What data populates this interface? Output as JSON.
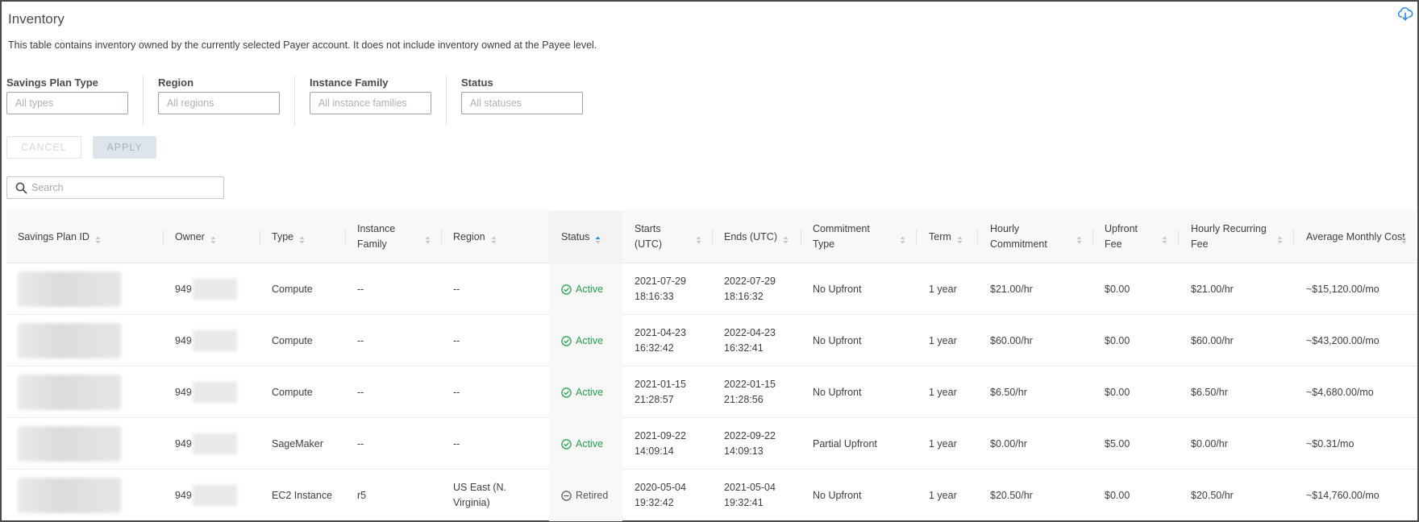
{
  "header": {
    "title": "Inventory",
    "description": "This table contains inventory owned by the currently selected Payer account. It does not include inventory owned at the Payee level.",
    "download_icon": "cloud-download-icon"
  },
  "filters": [
    {
      "label": "Savings Plan Type",
      "placeholder": "All types",
      "value": ""
    },
    {
      "label": "Region",
      "placeholder": "All regions",
      "value": ""
    },
    {
      "label": "Instance Family",
      "placeholder": "All instance families",
      "value": ""
    },
    {
      "label": "Status",
      "placeholder": "All statuses",
      "value": ""
    }
  ],
  "actions": {
    "cancel_label": "CANCEL",
    "apply_label": "APPLY"
  },
  "search": {
    "placeholder": "Search",
    "value": "",
    "icon": "search-icon"
  },
  "table": {
    "columns": [
      {
        "label": "Savings Plan ID",
        "sort": "none"
      },
      {
        "label": "Owner",
        "sort": "none"
      },
      {
        "label": "Type",
        "sort": "none"
      },
      {
        "label": "Instance Family",
        "sort": "none"
      },
      {
        "label": "Region",
        "sort": "none"
      },
      {
        "label": "Status",
        "sort": "ascending"
      },
      {
        "label": "Starts (UTC)",
        "sort": "none"
      },
      {
        "label": "Ends (UTC)",
        "sort": "none"
      },
      {
        "label": "Commitment Type",
        "sort": "none"
      },
      {
        "label": "Term",
        "sort": "none"
      },
      {
        "label": "Hourly Commitment",
        "sort": "none"
      },
      {
        "label": "Upfront Fee",
        "sort": "none"
      },
      {
        "label": "Hourly Recurring Fee",
        "sort": "none"
      },
      {
        "label": "Average Monthly Cost",
        "sort": "none"
      }
    ],
    "rows": [
      {
        "id": "[redacted]",
        "owner_prefix": "949",
        "type": "Compute",
        "instance_family": "--",
        "region": "--",
        "status": "Active",
        "starts": "2021-07-29 18:16:33",
        "ends": "2022-07-29 18:16:32",
        "commitment_type": "No Upfront",
        "term": "1 year",
        "hourly_commitment": "$21.00/hr",
        "upfront_fee": "$0.00",
        "hourly_recurring_fee": "$21.00/hr",
        "avg_monthly_cost": "~$15,120.00/mo"
      },
      {
        "id": "[redacted]",
        "owner_prefix": "949",
        "type": "Compute",
        "instance_family": "--",
        "region": "--",
        "status": "Active",
        "starts": "2021-04-23 16:32:42",
        "ends": "2022-04-23 16:32:41",
        "commitment_type": "No Upfront",
        "term": "1 year",
        "hourly_commitment": "$60.00/hr",
        "upfront_fee": "$0.00",
        "hourly_recurring_fee": "$60.00/hr",
        "avg_monthly_cost": "~$43,200.00/mo"
      },
      {
        "id": "[redacted]",
        "owner_prefix": "949",
        "type": "Compute",
        "instance_family": "--",
        "region": "--",
        "status": "Active",
        "starts": "2021-01-15 21:28:57",
        "ends": "2022-01-15 21:28:56",
        "commitment_type": "No Upfront",
        "term": "1 year",
        "hourly_commitment": "$6.50/hr",
        "upfront_fee": "$0.00",
        "hourly_recurring_fee": "$6.50/hr",
        "avg_monthly_cost": "~$4,680.00/mo"
      },
      {
        "id": "[redacted]",
        "owner_prefix": "949",
        "type": "SageMaker",
        "instance_family": "--",
        "region": "--",
        "status": "Active",
        "starts": "2021-09-22 14:09:14",
        "ends": "2022-09-22 14:09:13",
        "commitment_type": "Partial Upfront",
        "term": "1 year",
        "hourly_commitment": "$0.00/hr",
        "upfront_fee": "$5.00",
        "hourly_recurring_fee": "$0.00/hr",
        "avg_monthly_cost": "~$0.31/mo"
      },
      {
        "id": "[redacted]",
        "owner_prefix": "949",
        "type": "EC2 Instance",
        "instance_family": "r5",
        "region": "US East (N. Virginia)",
        "status": "Retired",
        "starts": "2020-05-04 19:32:42",
        "ends": "2021-05-04 19:32:41",
        "commitment_type": "No Upfront",
        "term": "1 year",
        "hourly_commitment": "$20.50/hr",
        "upfront_fee": "$0.00",
        "hourly_recurring_fee": "$20.50/hr",
        "avg_monthly_cost": "~$14,760.00/mo"
      }
    ]
  },
  "colors": {
    "accent": "#2b8ae6",
    "active": "#1f9d4c",
    "retired": "#555555",
    "header_bg": "#f8f8f8"
  }
}
